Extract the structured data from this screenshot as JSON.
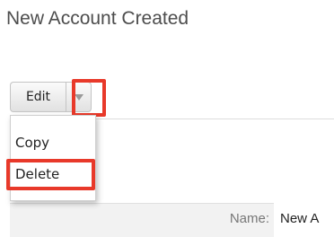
{
  "page": {
    "title": "New Account Created"
  },
  "actions": {
    "edit_label": "Edit",
    "caret_icon": "caret-down-icon",
    "menu": [
      {
        "label": "Copy"
      },
      {
        "label": "Delete"
      }
    ]
  },
  "record": {
    "name_label": "Name:",
    "name_value": "New A"
  },
  "colors": {
    "highlight": "#e8392a",
    "title": "#4d4d4d"
  }
}
